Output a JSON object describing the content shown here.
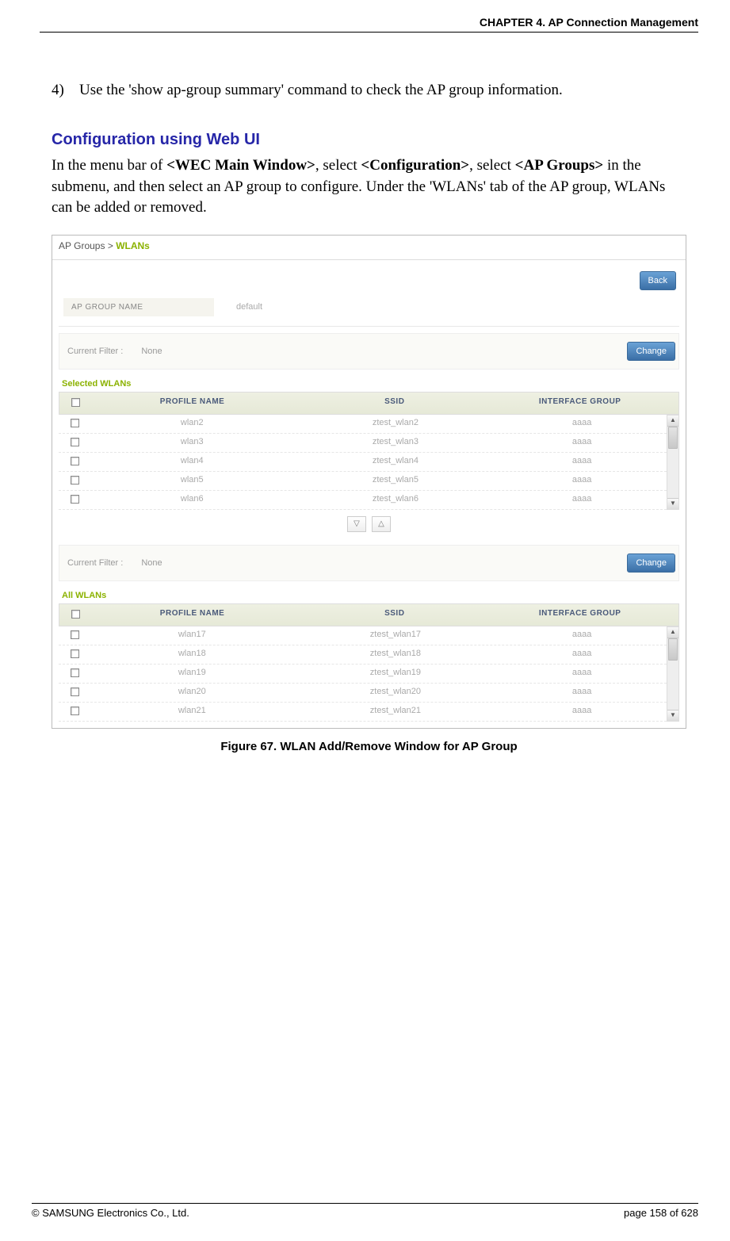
{
  "header": {
    "chapter": "CHAPTER 4. AP Connection Management"
  },
  "step": {
    "number": "4)",
    "text": "Use the 'show ap-group summary' command to check the AP group information."
  },
  "section_heading": "Configuration using Web UI",
  "paragraph": {
    "prefix": "In the menu bar of ",
    "b1": "<WEC Main Window>",
    "mid1": ", select ",
    "b2": "<Configuration>",
    "mid2": ", select ",
    "b3": "<AP Groups>",
    "suffix": " in the submenu, and then select an AP group to configure. Under the 'WLANs' tab of the AP group, WLANs can be added or removed."
  },
  "screenshot": {
    "breadcrumb": {
      "root": "AP Groups",
      "sep": ">",
      "active": "WLANs"
    },
    "buttons": {
      "back": "Back",
      "change": "Change"
    },
    "group_name": {
      "label": "AP GROUP NAME",
      "value": "default"
    },
    "filter": {
      "label": "Current Filter :",
      "value": "None"
    },
    "selected_label": "Selected WLANs",
    "all_label": "All WLANs",
    "headers": {
      "profile": "PROFILE NAME",
      "ssid": "SSID",
      "if": "INTERFACE GROUP"
    },
    "move": {
      "down": "▽",
      "up": "△"
    },
    "selected_rows": [
      {
        "profile": "wlan2",
        "ssid": "ztest_wlan2",
        "if": "aaaa"
      },
      {
        "profile": "wlan3",
        "ssid": "ztest_wlan3",
        "if": "aaaa"
      },
      {
        "profile": "wlan4",
        "ssid": "ztest_wlan4",
        "if": "aaaa"
      },
      {
        "profile": "wlan5",
        "ssid": "ztest_wlan5",
        "if": "aaaa"
      },
      {
        "profile": "wlan6",
        "ssid": "ztest_wlan6",
        "if": "aaaa"
      }
    ],
    "all_rows": [
      {
        "profile": "wlan17",
        "ssid": "ztest_wlan17",
        "if": "aaaa"
      },
      {
        "profile": "wlan18",
        "ssid": "ztest_wlan18",
        "if": "aaaa"
      },
      {
        "profile": "wlan19",
        "ssid": "ztest_wlan19",
        "if": "aaaa"
      },
      {
        "profile": "wlan20",
        "ssid": "ztest_wlan20",
        "if": "aaaa"
      },
      {
        "profile": "wlan21",
        "ssid": "ztest_wlan21",
        "if": "aaaa"
      }
    ]
  },
  "figure_caption": "Figure 67. WLAN Add/Remove Window for AP Group",
  "footer": {
    "copyright": "© SAMSUNG Electronics Co., Ltd.",
    "page": "page 158 of 628"
  }
}
